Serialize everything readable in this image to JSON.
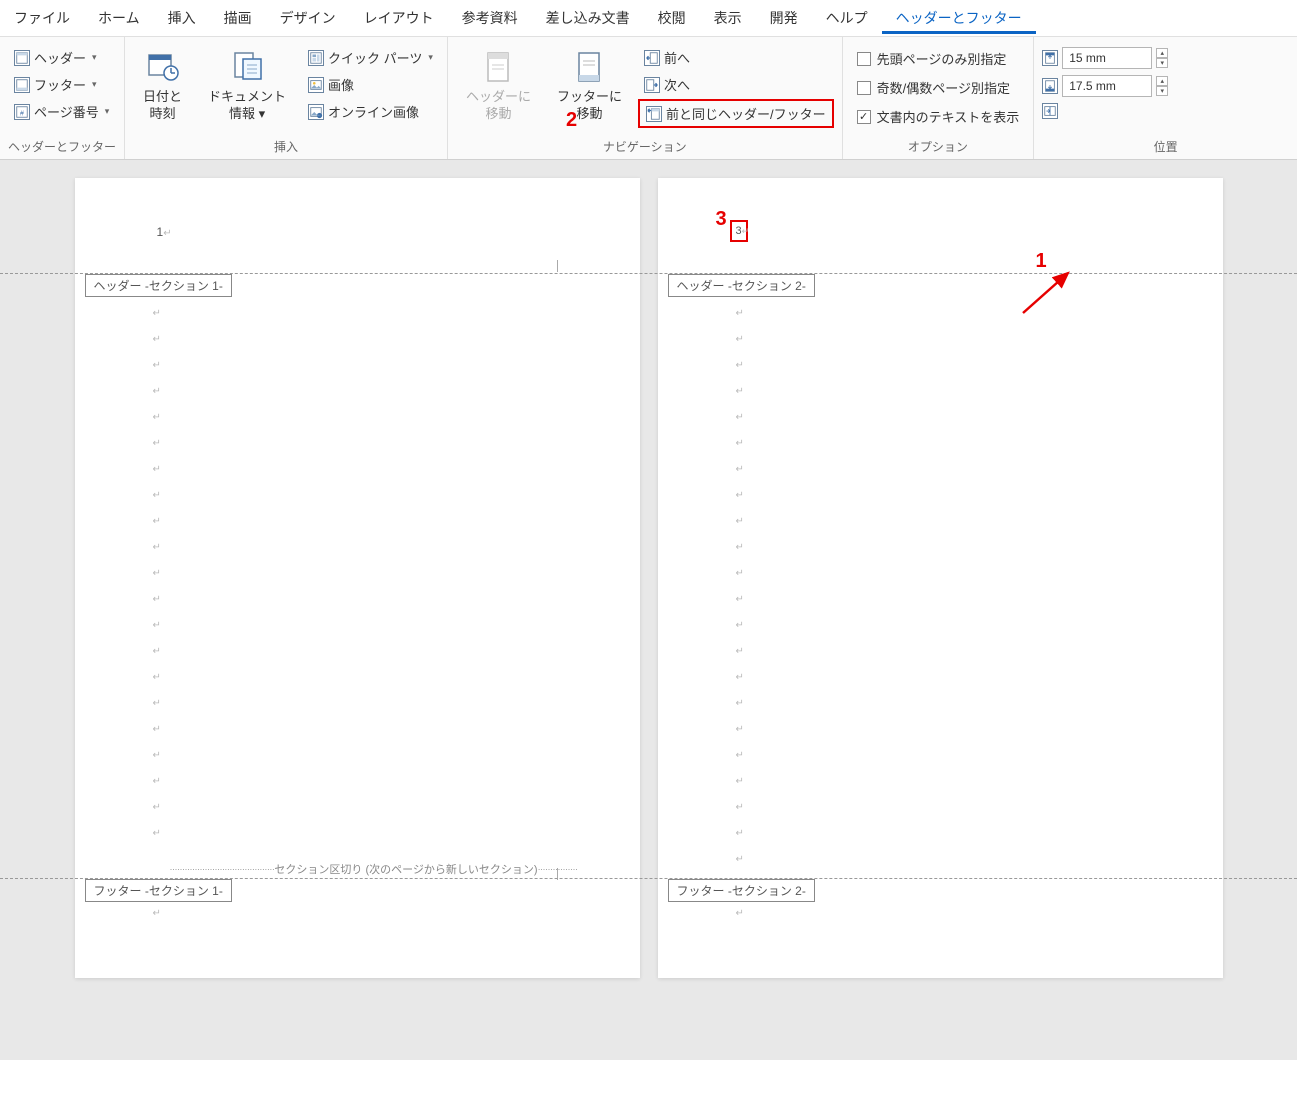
{
  "menubar": {
    "items": [
      "ファイル",
      "ホーム",
      "挿入",
      "描画",
      "デザイン",
      "レイアウト",
      "参考資料",
      "差し込み文書",
      "校閲",
      "表示",
      "開発",
      "ヘルプ",
      "ヘッダーとフッター"
    ],
    "active_index": 12
  },
  "ribbon": {
    "group_hf": {
      "label": "ヘッダーとフッター",
      "header": "ヘッダー",
      "footer": "フッター",
      "pagenum": "ページ番号"
    },
    "group_insert": {
      "label": "挿入",
      "datetime_l1": "日付と",
      "datetime_l2": "時刻",
      "docinfo_l1": "ドキュメント",
      "docinfo_l2": "情報",
      "quickparts": "クイック パーツ",
      "picture": "画像",
      "onlinepic": "オンライン画像"
    },
    "group_nav": {
      "label": "ナビゲーション",
      "gotoheader_l1": "ヘッダーに",
      "gotoheader_l2": "移動",
      "gotofooter_l1": "フッターに",
      "gotofooter_l2": "移動",
      "prev": "前へ",
      "next": "次へ",
      "linkprev": "前と同じヘッダー/フッター"
    },
    "group_options": {
      "label": "オプション",
      "firstpage": "先頭ページのみ別指定",
      "oddeven": "奇数/偶数ページ別指定",
      "showtext": "文書内のテキストを表示",
      "firstpage_checked": false,
      "oddeven_checked": false,
      "showtext_checked": true
    },
    "group_position": {
      "label": "位置",
      "header_dist": "15 mm",
      "footer_dist": "17.5 mm"
    }
  },
  "doc": {
    "page1_num": "1",
    "page2_num": "3",
    "header_tag1": "ヘッダー -セクション 1-",
    "header_tag2": "ヘッダー -セクション 2-",
    "footer_tag1": "フッター -セクション 1-",
    "footer_tag2": "フッター -セクション 2-",
    "section_break_label": "セクション区切り (次のページから新しいセクション)"
  },
  "annotations": {
    "n1": "1",
    "n2": "2",
    "n3": "3"
  }
}
